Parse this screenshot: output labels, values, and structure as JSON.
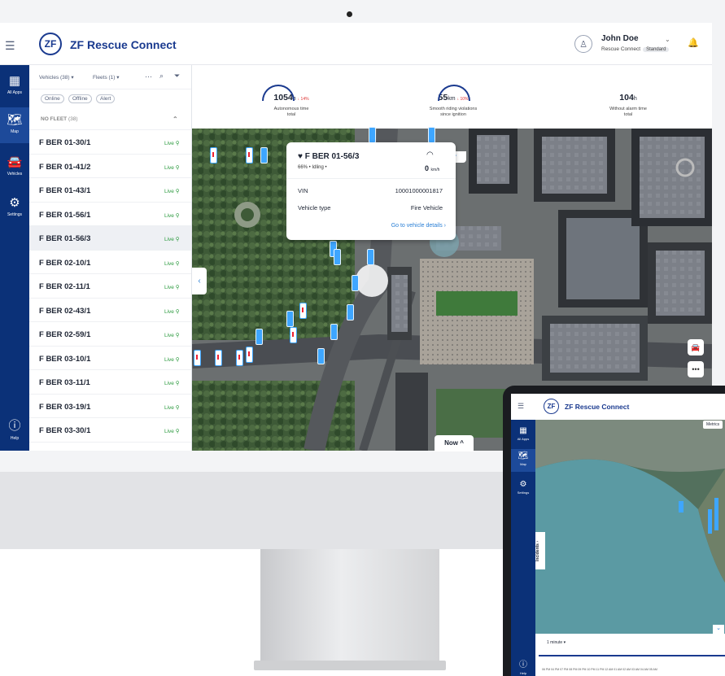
{
  "app": {
    "brand": "ZF Rescue Connect",
    "logo_letters": "ZF",
    "accent": "#1a3a8f",
    "nav_bg": "#0b3178",
    "live_color": "#2b9a3e",
    "link_color": "#2a7fd5"
  },
  "user": {
    "name": "John Doe",
    "org": "Rescue Connect",
    "plan": "Standard"
  },
  "nav": {
    "items": [
      {
        "label": "All Apps",
        "icon": "grid-icon"
      },
      {
        "label": "Map",
        "icon": "map-icon"
      },
      {
        "label": "Vehicles",
        "icon": "car-icon"
      },
      {
        "label": "Settings",
        "icon": "gear-icon"
      }
    ],
    "help": "Help"
  },
  "filters": {
    "vehicles": "Vehicles (38) ▾",
    "fleets": "Fleets (1) ▾",
    "chips": [
      "Online",
      "Offline",
      "Alert"
    ]
  },
  "group": {
    "label": "NO FLEET",
    "count": "(38)"
  },
  "vehicles": [
    {
      "name": "F BER 01-30/1",
      "status": "Live"
    },
    {
      "name": "F BER 01-41/2",
      "status": "Live"
    },
    {
      "name": "F BER 01-43/1",
      "status": "Live"
    },
    {
      "name": "F BER 01-56/1",
      "status": "Live"
    },
    {
      "name": "F BER 01-56/3",
      "status": "Live"
    },
    {
      "name": "F BER 02-10/1",
      "status": "Live"
    },
    {
      "name": "F BER 02-11/1",
      "status": "Live"
    },
    {
      "name": "F BER 02-43/1",
      "status": "Live"
    },
    {
      "name": "F BER 02-59/1",
      "status": "Live"
    },
    {
      "name": "F BER 03-10/1",
      "status": "Live"
    },
    {
      "name": "F BER 03-11/1",
      "status": "Live"
    },
    {
      "name": "F BER 03-19/1",
      "status": "Live"
    },
    {
      "name": "F BER 03-30/1",
      "status": "Live"
    }
  ],
  "stats": [
    {
      "value": "1054",
      "unit": "h",
      "change": "↓ 14%",
      "label_1": "Autonomous time",
      "label_2": "total"
    },
    {
      "value": "55",
      "unit": "km",
      "change": "↓ 10%",
      "label_1": "Smooth riding violations",
      "label_2": "since ignition"
    },
    {
      "value": "104",
      "unit": "h",
      "change": "",
      "label_1": "Without alarm time",
      "label_2": "total"
    }
  ],
  "popup": {
    "title": "F BER 01-56/3",
    "subtitle": "66% • Idling •",
    "speed": "0",
    "speed_unit": "km/h",
    "vin_label": "VIN",
    "vin_value": "10001000001817",
    "type_label": "Vehicle type",
    "type_value": "Fire Vehicle",
    "link": "Go to vehicle details ›"
  },
  "map_controls": {
    "now": "Now ^",
    "more": "•••"
  },
  "tablet": {
    "metrics": "Metrics",
    "incidents": "Incidents ›",
    "interval": "1 minute ▾",
    "times": "06 PM  04 PM  07 PM  08 PM  09 PM  10 PM  11 PM  12 AM  01 AM  02 AM  03 AM  04 AM  05 AM",
    "nav": [
      "All Apps",
      "Map",
      "Settings"
    ]
  }
}
